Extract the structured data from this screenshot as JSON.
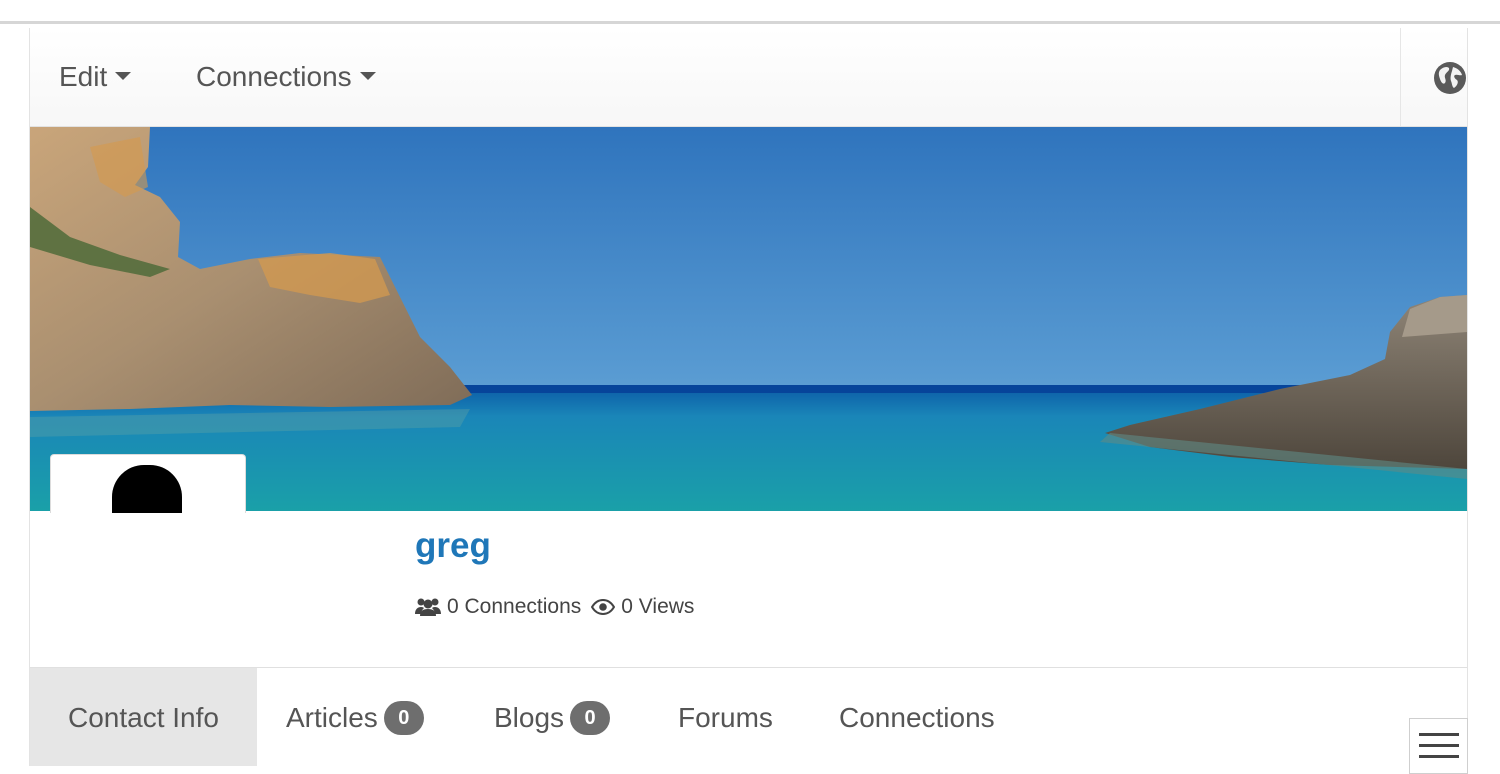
{
  "navbar": {
    "menu": [
      {
        "label": "Edit",
        "has_caret": true
      },
      {
        "label": "Connections",
        "has_caret": true
      }
    ],
    "right_icon": "globe-icon"
  },
  "cover_photo": {
    "description_icon": "cover-image",
    "colors": {
      "sky": "#3f87c6",
      "sea": "#1f9ab9",
      "rock": "#bfa27c"
    }
  },
  "profile": {
    "name": "greg",
    "name_color": "#1f77b8",
    "connections_icon": "users-icon",
    "connections_text": "0 Connections",
    "views_icon": "eye-icon",
    "views_text": "0 Views"
  },
  "tabs": [
    {
      "label": "Contact Info",
      "active": true
    },
    {
      "label": "Articles",
      "badge": "0"
    },
    {
      "label": "Blogs",
      "badge": "0"
    },
    {
      "label": "Forums"
    },
    {
      "label": "Connections"
    }
  ],
  "mobile_menu_icon": "hamburger-menu-icon"
}
